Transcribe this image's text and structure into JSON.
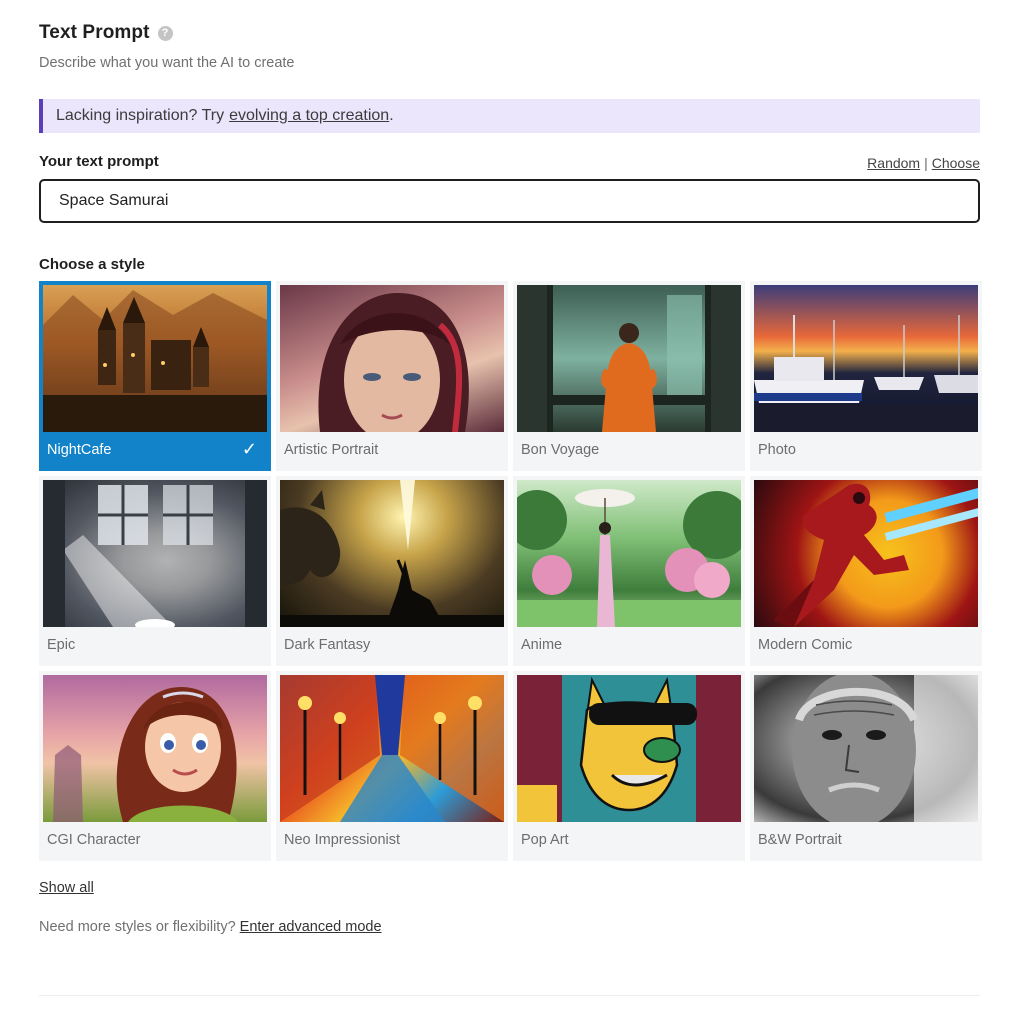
{
  "header": {
    "title": "Text Prompt",
    "help_icon": "help-icon",
    "subtitle": "Describe what you want the AI to create"
  },
  "tip": {
    "text": "Lacking inspiration? Try",
    "link": "evolving a top creation",
    "suffix": ".",
    "accent_color": "#5b3fb6",
    "background": "#ebe6fc"
  },
  "prompt": {
    "label": "Your text prompt",
    "random_label": "Random",
    "separator": "|",
    "choose_label": "Choose",
    "value": "Space Samurai"
  },
  "styles": {
    "label": "Choose a style",
    "selected_color": "#1283c9",
    "selected": "NightCafe",
    "items": [
      {
        "label": "NightCafe",
        "selected": true
      },
      {
        "label": "Artistic Portrait",
        "selected": false
      },
      {
        "label": "Bon Voyage",
        "selected": false
      },
      {
        "label": "Photo",
        "selected": false
      },
      {
        "label": "Epic",
        "selected": false
      },
      {
        "label": "Dark Fantasy",
        "selected": false
      },
      {
        "label": "Anime",
        "selected": false
      },
      {
        "label": "Modern Comic",
        "selected": false
      },
      {
        "label": "CGI Character",
        "selected": false
      },
      {
        "label": "Neo Impressionist",
        "selected": false
      },
      {
        "label": "Pop Art",
        "selected": false
      },
      {
        "label": "B&W Portrait",
        "selected": false
      }
    ]
  },
  "footer": {
    "show_all": "Show all",
    "more_text": "Need more styles or flexibility?",
    "advanced_link": "Enter advanced mode"
  }
}
